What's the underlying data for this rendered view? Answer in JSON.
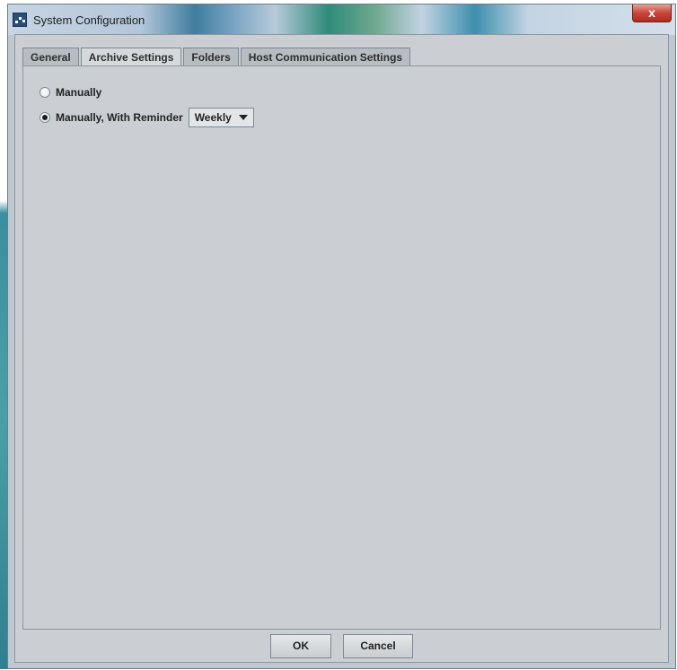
{
  "window": {
    "title": "System Configuration",
    "close_glyph": "x"
  },
  "tabs": [
    {
      "label": "General",
      "active": false
    },
    {
      "label": "Archive Settings",
      "active": true
    },
    {
      "label": "Folders",
      "active": false
    },
    {
      "label": "Host Communication Settings",
      "active": false
    }
  ],
  "archive": {
    "option_manual": {
      "label": "Manually",
      "checked": false
    },
    "option_reminder": {
      "label": "Manually, With Reminder",
      "checked": true
    },
    "reminder_frequency": "Weekly"
  },
  "buttons": {
    "ok": "OK",
    "cancel": "Cancel"
  }
}
